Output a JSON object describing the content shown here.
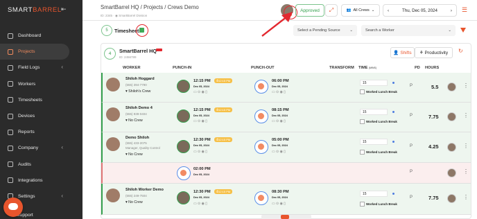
{
  "sidebar": {
    "logo_prefix": "SMART",
    "logo_brand": "BARREL",
    "items": [
      {
        "label": "Dashboard",
        "icon": "grid-icon",
        "active": false
      },
      {
        "label": "Projects",
        "icon": "folder-icon",
        "active": true
      },
      {
        "label": "Field Logs",
        "icon": "clipboard-icon",
        "active": false,
        "chevron": true
      },
      {
        "label": "Workers",
        "icon": "users-icon",
        "active": false
      },
      {
        "label": "Timesheets",
        "icon": "clock-icon",
        "active": false
      },
      {
        "label": "Devices",
        "icon": "device-icon",
        "active": false
      },
      {
        "label": "Reports",
        "icon": "chart-icon",
        "active": false
      },
      {
        "label": "Company",
        "icon": "building-icon",
        "active": false,
        "chevron": true
      },
      {
        "label": "Audits",
        "icon": "audit-icon",
        "active": false
      },
      {
        "label": "Integrations",
        "icon": "plug-icon",
        "active": false
      },
      {
        "label": "Settings",
        "icon": "gear-icon",
        "active": false,
        "chevron": true
      }
    ],
    "support_label": "Support"
  },
  "header": {
    "breadcrumb": "SmartBarrel HQ  /  Projects  /  Crews Demo",
    "sub": "ID: 2345  ·  ◉ SmartBarrel Division",
    "approved_label": "Approved",
    "crews_label": "All Crews",
    "date": "Thu, Dec 05, 2024"
  },
  "toolbar": {
    "count": "5",
    "title": "Timesheets",
    "pending_source_placeholder": "Select a Pending Source",
    "worker_search_placeholder": "Search a Worker"
  },
  "card": {
    "count": "4",
    "title": "SmartBarrel HQ",
    "sub": "ID: 2456789",
    "shifts_label": "Shifts",
    "productivity_label": "Productivity",
    "columns": {
      "worker": "WORKER",
      "punch_in": "PUNCH-IN",
      "punch_out": "PUNCH-OUT",
      "transform": "TRANSFORM",
      "time": "TIME",
      "time_unit": "(MINS)",
      "pd": "PD",
      "hours": "HOURS"
    }
  },
  "rows": [
    {
      "name": "Shiloh Hoggard",
      "phone": "(555) 394-7790",
      "crew": "Shiloh's Crew",
      "punch_in_time": "12:15 PM",
      "punch_in_date": "Dec 05, 2024",
      "punch_in_tag": "12:15 PM",
      "punch_out_time": "06:00 PM",
      "punch_out_date": "Dec 05, 2024",
      "break_mins": "15",
      "break_label": "Worked Lunch Break",
      "pd": "P",
      "hours": "5.5"
    },
    {
      "name": "Shiloh Demo 4",
      "phone": "(555) 939-0404",
      "crew": "No Crew",
      "punch_in_time": "12:15 PM",
      "punch_in_date": "Dec 05, 2024",
      "punch_in_tag": "12:15 PM",
      "punch_out_time": "08:15 PM",
      "punch_out_date": "Dec 05, 2024",
      "break_mins": "15",
      "break_label": "Worked Lunch Break",
      "pd": "P",
      "hours": "7.75"
    },
    {
      "name": "Demo Shiloh",
      "phone": "(555) 433-2075",
      "role": "Manager, Quality Control",
      "crew": "No Crew",
      "punch_in_time": "12:30 PM",
      "punch_in_date": "Dec 05, 2024",
      "punch_in_tag": "12:15 PM",
      "punch_out_time": "05:00 PM",
      "punch_out_date": "Dec 05, 2024",
      "break_mins": "15",
      "break_label": "Worked Lunch Break",
      "pd": "P",
      "hours": "4.25"
    },
    {
      "punch_in_time": "02:00 PM",
      "punch_in_date": "Dec 05, 2024",
      "pd": "P"
    },
    {
      "name": "Shiloh Worker Demo",
      "phone": "(555) 249-7504",
      "crew": "No Crew",
      "punch_in_time": "12:30 PM",
      "punch_in_date": "Dec 05, 2024",
      "punch_in_tag": "12:15 PM",
      "punch_out_time": "08:30 PM",
      "punch_out_date": "Dec 05, 2024",
      "break_mins": "15",
      "break_label": "Worked Lunch Break",
      "pd": "P",
      "hours": "7.75"
    }
  ],
  "colors": {
    "accent": "#e8552d",
    "approved_green": "#35a04e",
    "annotation_red": "#e3282f",
    "sidebar_bg": "#2b2b2b",
    "row_green_bg": "#eef6ef",
    "row_red_bg": "#fbeeee"
  }
}
